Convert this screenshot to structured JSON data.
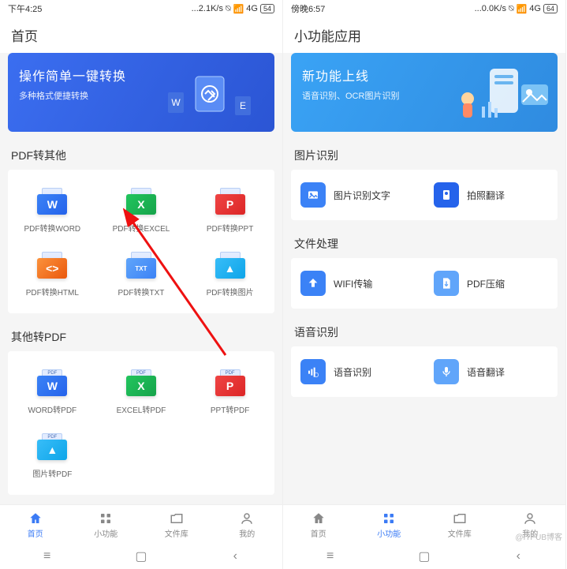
{
  "left": {
    "status": {
      "time": "下午4:25",
      "net": "...2.1K/s",
      "signal": "4G",
      "battery": "54"
    },
    "title": "首页",
    "banner": {
      "title": "操作简单一键转换",
      "sub": "多种格式便捷转换"
    },
    "section1": {
      "title": "PDF转其他",
      "items": [
        {
          "label": "PDF转换WORD",
          "glyph": "W",
          "cls": "word-c"
        },
        {
          "label": "PDF转换EXCEL",
          "glyph": "X",
          "cls": "excel-c"
        },
        {
          "label": "PDF转换PPT",
          "glyph": "P",
          "cls": "ppt-c"
        },
        {
          "label": "PDF转换HTML",
          "glyph": "<>",
          "cls": "html-c"
        },
        {
          "label": "PDF转换TXT",
          "glyph": "TXT",
          "cls": "txt-c"
        },
        {
          "label": "PDF转换图片",
          "glyph": "▲",
          "cls": "img-c"
        }
      ]
    },
    "section2": {
      "title": "其他转PDF",
      "items": [
        {
          "label": "WORD转PDF",
          "glyph": "W",
          "cls": "word-c"
        },
        {
          "label": "EXCEL转PDF",
          "glyph": "X",
          "cls": "excel-c"
        },
        {
          "label": "PPT转PDF",
          "glyph": "P",
          "cls": "ppt-c"
        },
        {
          "label": "图片转PDF",
          "glyph": "▲",
          "cls": "img-c"
        }
      ]
    },
    "nav": [
      {
        "label": "首页",
        "active": true
      },
      {
        "label": "小功能",
        "active": false
      },
      {
        "label": "文件库",
        "active": false
      },
      {
        "label": "我的",
        "active": false
      }
    ]
  },
  "right": {
    "status": {
      "time": "傍晚6:57",
      "net": "...0.0K/s",
      "signal": "4G",
      "battery": "64"
    },
    "title": "小功能应用",
    "banner": {
      "title": "新功能上线",
      "sub": "语音识别、OCR图片识别"
    },
    "sections": [
      {
        "title": "图片识别",
        "items": [
          {
            "label": "图片识别文字",
            "color": "#3b82f6"
          },
          {
            "label": "拍照翻译",
            "color": "#2563eb"
          }
        ]
      },
      {
        "title": "文件处理",
        "items": [
          {
            "label": "WIFI传输",
            "color": "#3b82f6"
          },
          {
            "label": "PDF压缩",
            "color": "#60a5fa"
          }
        ]
      },
      {
        "title": "语音识别",
        "items": [
          {
            "label": "语音识别",
            "color": "#3b82f6"
          },
          {
            "label": "语音翻译",
            "color": "#60a5fa"
          }
        ]
      }
    ],
    "nav": [
      {
        "label": "首页",
        "active": false
      },
      {
        "label": "小功能",
        "active": true
      },
      {
        "label": "文件库",
        "active": false
      },
      {
        "label": "我的",
        "active": false
      }
    ]
  },
  "watermark": "@ITPUB博客"
}
